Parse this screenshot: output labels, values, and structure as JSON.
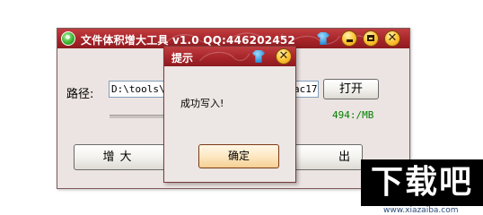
{
  "main_window": {
    "title": "文件体积增大工具 v1.0  QQ:446202452",
    "minimize_icon": "minimize-icon",
    "maximize_icon": "maximize-icon",
    "close_glyph": "✕",
    "path_label": "路径:",
    "path_value_start": "D:\\tools\\桌",
    "path_value_end": "ac17",
    "open_button_label": "打开",
    "size_label": "494:/MB",
    "enlarge_button_label": "增大",
    "exit_button_label": "出"
  },
  "dialog": {
    "title": "提示",
    "close_glyph": "✕",
    "message": "成功写入!",
    "ok_button_label": "确定"
  },
  "watermark": {
    "logo_text": "下载吧",
    "url": "www.xiazaiba.com"
  },
  "colors": {
    "titlebar": "#a8252a",
    "window_bg": "#ece4e2",
    "size_label": "#008000"
  }
}
